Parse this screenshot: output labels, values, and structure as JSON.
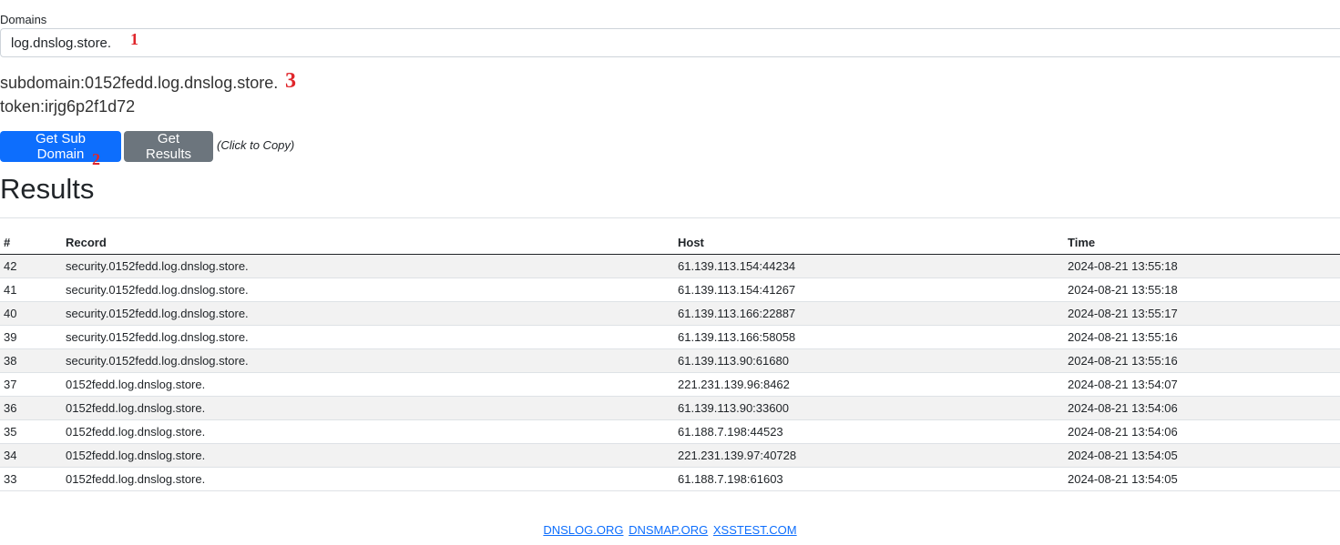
{
  "form": {
    "domains_label": "Domains",
    "domain_value": "log.dnslog.store."
  },
  "info": {
    "subdomain": "subdomain:0152fedd.log.dnslog.store.",
    "token": "token:irjg6p2f1d72"
  },
  "annotations": {
    "one": "1",
    "two": "2",
    "three": "3"
  },
  "buttons": {
    "get_sub_domain": "Get Sub Domain",
    "get_results": "Get Results",
    "copy_hint": "(Click to Copy)"
  },
  "results": {
    "heading": "Results",
    "columns": [
      "#",
      "Record",
      "Host",
      "Time"
    ],
    "rows": [
      {
        "num": "42",
        "record": "security.0152fedd.log.dnslog.store.",
        "host": "61.139.113.154:44234",
        "time": "2024-08-21 13:55:18"
      },
      {
        "num": "41",
        "record": "security.0152fedd.log.dnslog.store.",
        "host": "61.139.113.154:41267",
        "time": "2024-08-21 13:55:18"
      },
      {
        "num": "40",
        "record": "security.0152fedd.log.dnslog.store.",
        "host": "61.139.113.166:22887",
        "time": "2024-08-21 13:55:17"
      },
      {
        "num": "39",
        "record": "security.0152fedd.log.dnslog.store.",
        "host": "61.139.113.166:58058",
        "time": "2024-08-21 13:55:16"
      },
      {
        "num": "38",
        "record": "security.0152fedd.log.dnslog.store.",
        "host": "61.139.113.90:61680",
        "time": "2024-08-21 13:55:16"
      },
      {
        "num": "37",
        "record": "0152fedd.log.dnslog.store.",
        "host": "221.231.139.96:8462",
        "time": "2024-08-21 13:54:07"
      },
      {
        "num": "36",
        "record": "0152fedd.log.dnslog.store.",
        "host": "61.139.113.90:33600",
        "time": "2024-08-21 13:54:06"
      },
      {
        "num": "35",
        "record": "0152fedd.log.dnslog.store.",
        "host": "61.188.7.198:44523",
        "time": "2024-08-21 13:54:06"
      },
      {
        "num": "34",
        "record": "0152fedd.log.dnslog.store.",
        "host": "221.231.139.97:40728",
        "time": "2024-08-21 13:54:05"
      },
      {
        "num": "33",
        "record": "0152fedd.log.dnslog.store.",
        "host": "61.188.7.198:61603",
        "time": "2024-08-21 13:54:05"
      }
    ]
  },
  "footer": {
    "links": [
      "DNSLOG.ORG",
      "DNSMAP.ORG",
      "XSSTEST.COM"
    ]
  },
  "colors": {
    "primary_button": "#0d6efd",
    "secondary_button": "#6c757d",
    "annotation": "#e0262b",
    "link": "#0d6efd"
  }
}
